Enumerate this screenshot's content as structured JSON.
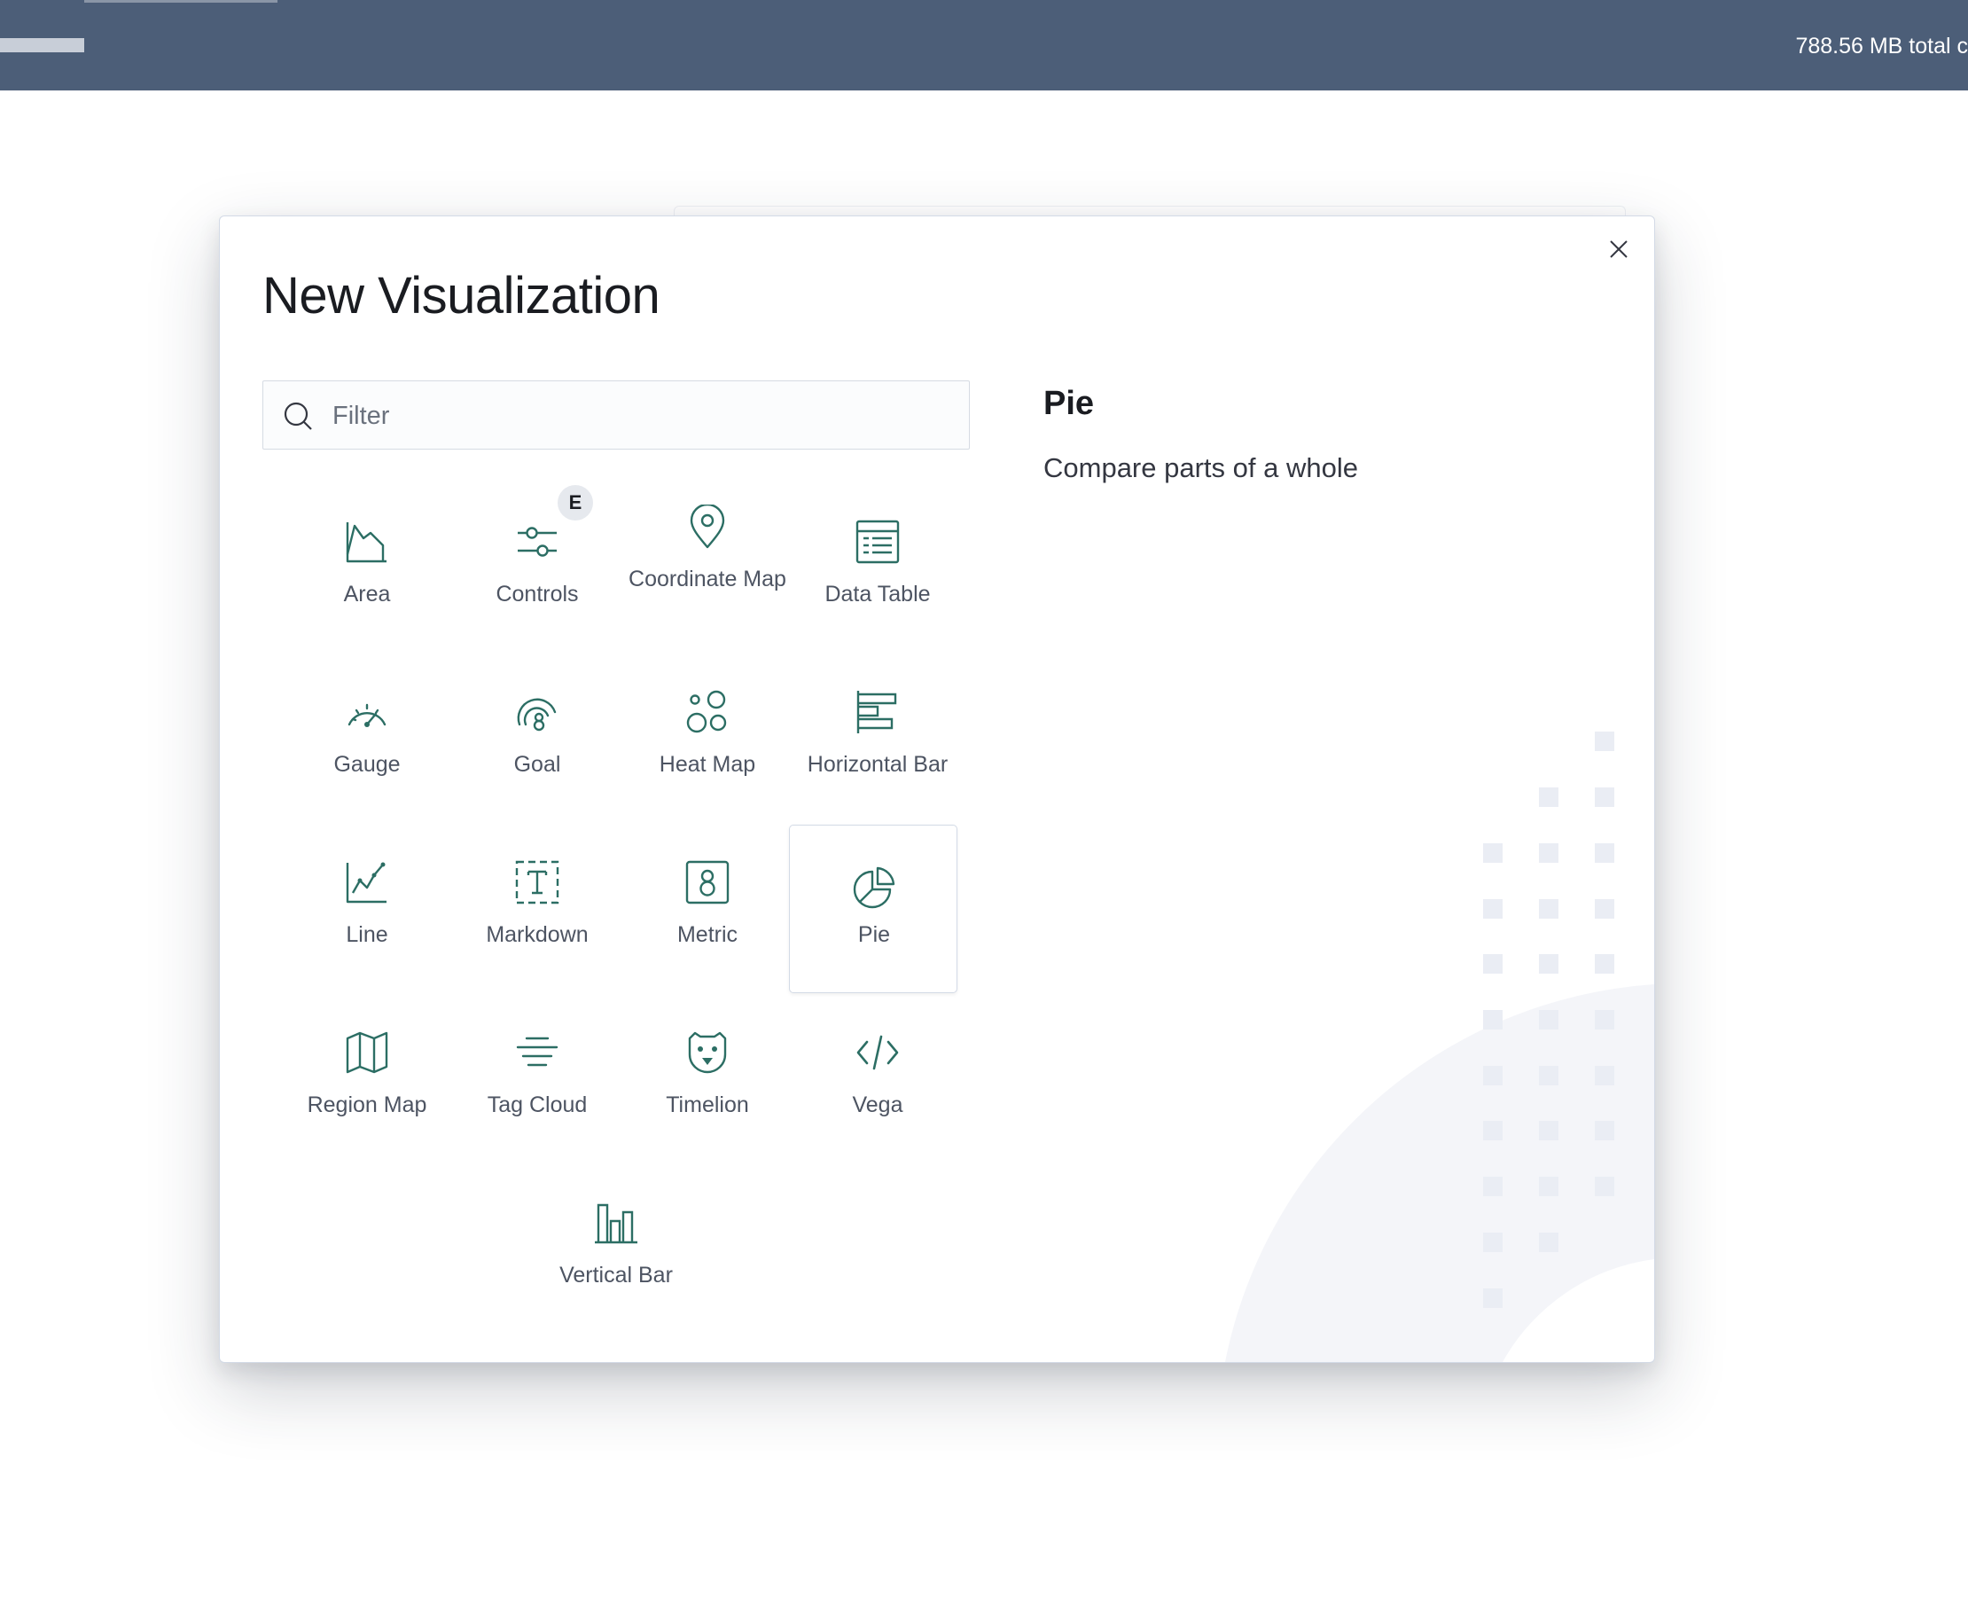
{
  "header": {
    "memory_text": "788.56 MB total c"
  },
  "modal": {
    "title": "New Visualization",
    "close_icon": "close-icon",
    "filter": {
      "placeholder": "Filter",
      "value": "",
      "icon": "search-icon"
    },
    "types": [
      {
        "label": "Area",
        "icon": "area-chart-icon"
      },
      {
        "label": "Controls",
        "icon": "controls-icon",
        "badge": "E"
      },
      {
        "label": "Coordinate Map",
        "icon": "map-pin-icon"
      },
      {
        "label": "Data Table",
        "icon": "data-table-icon"
      },
      {
        "label": "Gauge",
        "icon": "gauge-icon"
      },
      {
        "label": "Goal",
        "icon": "goal-icon"
      },
      {
        "label": "Heat Map",
        "icon": "heat-map-icon"
      },
      {
        "label": "Horizontal Bar",
        "icon": "horizontal-bar-icon"
      },
      {
        "label": "Line",
        "icon": "line-chart-icon"
      },
      {
        "label": "Markdown",
        "icon": "markdown-icon"
      },
      {
        "label": "Metric",
        "icon": "metric-icon"
      },
      {
        "label": "Pie",
        "icon": "pie-chart-icon",
        "selected": true
      },
      {
        "label": "Region Map",
        "icon": "region-map-icon"
      },
      {
        "label": "Tag Cloud",
        "icon": "tag-cloud-icon"
      },
      {
        "label": "Timelion",
        "icon": "timelion-icon"
      },
      {
        "label": "Vega",
        "icon": "code-icon"
      },
      {
        "label": "Vertical Bar",
        "icon": "vertical-bar-icon"
      }
    ],
    "description": {
      "title": "Pie",
      "body": "Compare parts of a whole"
    }
  },
  "colors": {
    "header_bg": "#4c5e78",
    "icon_accent": "#2c6e64",
    "label_text": "#4d5462"
  }
}
